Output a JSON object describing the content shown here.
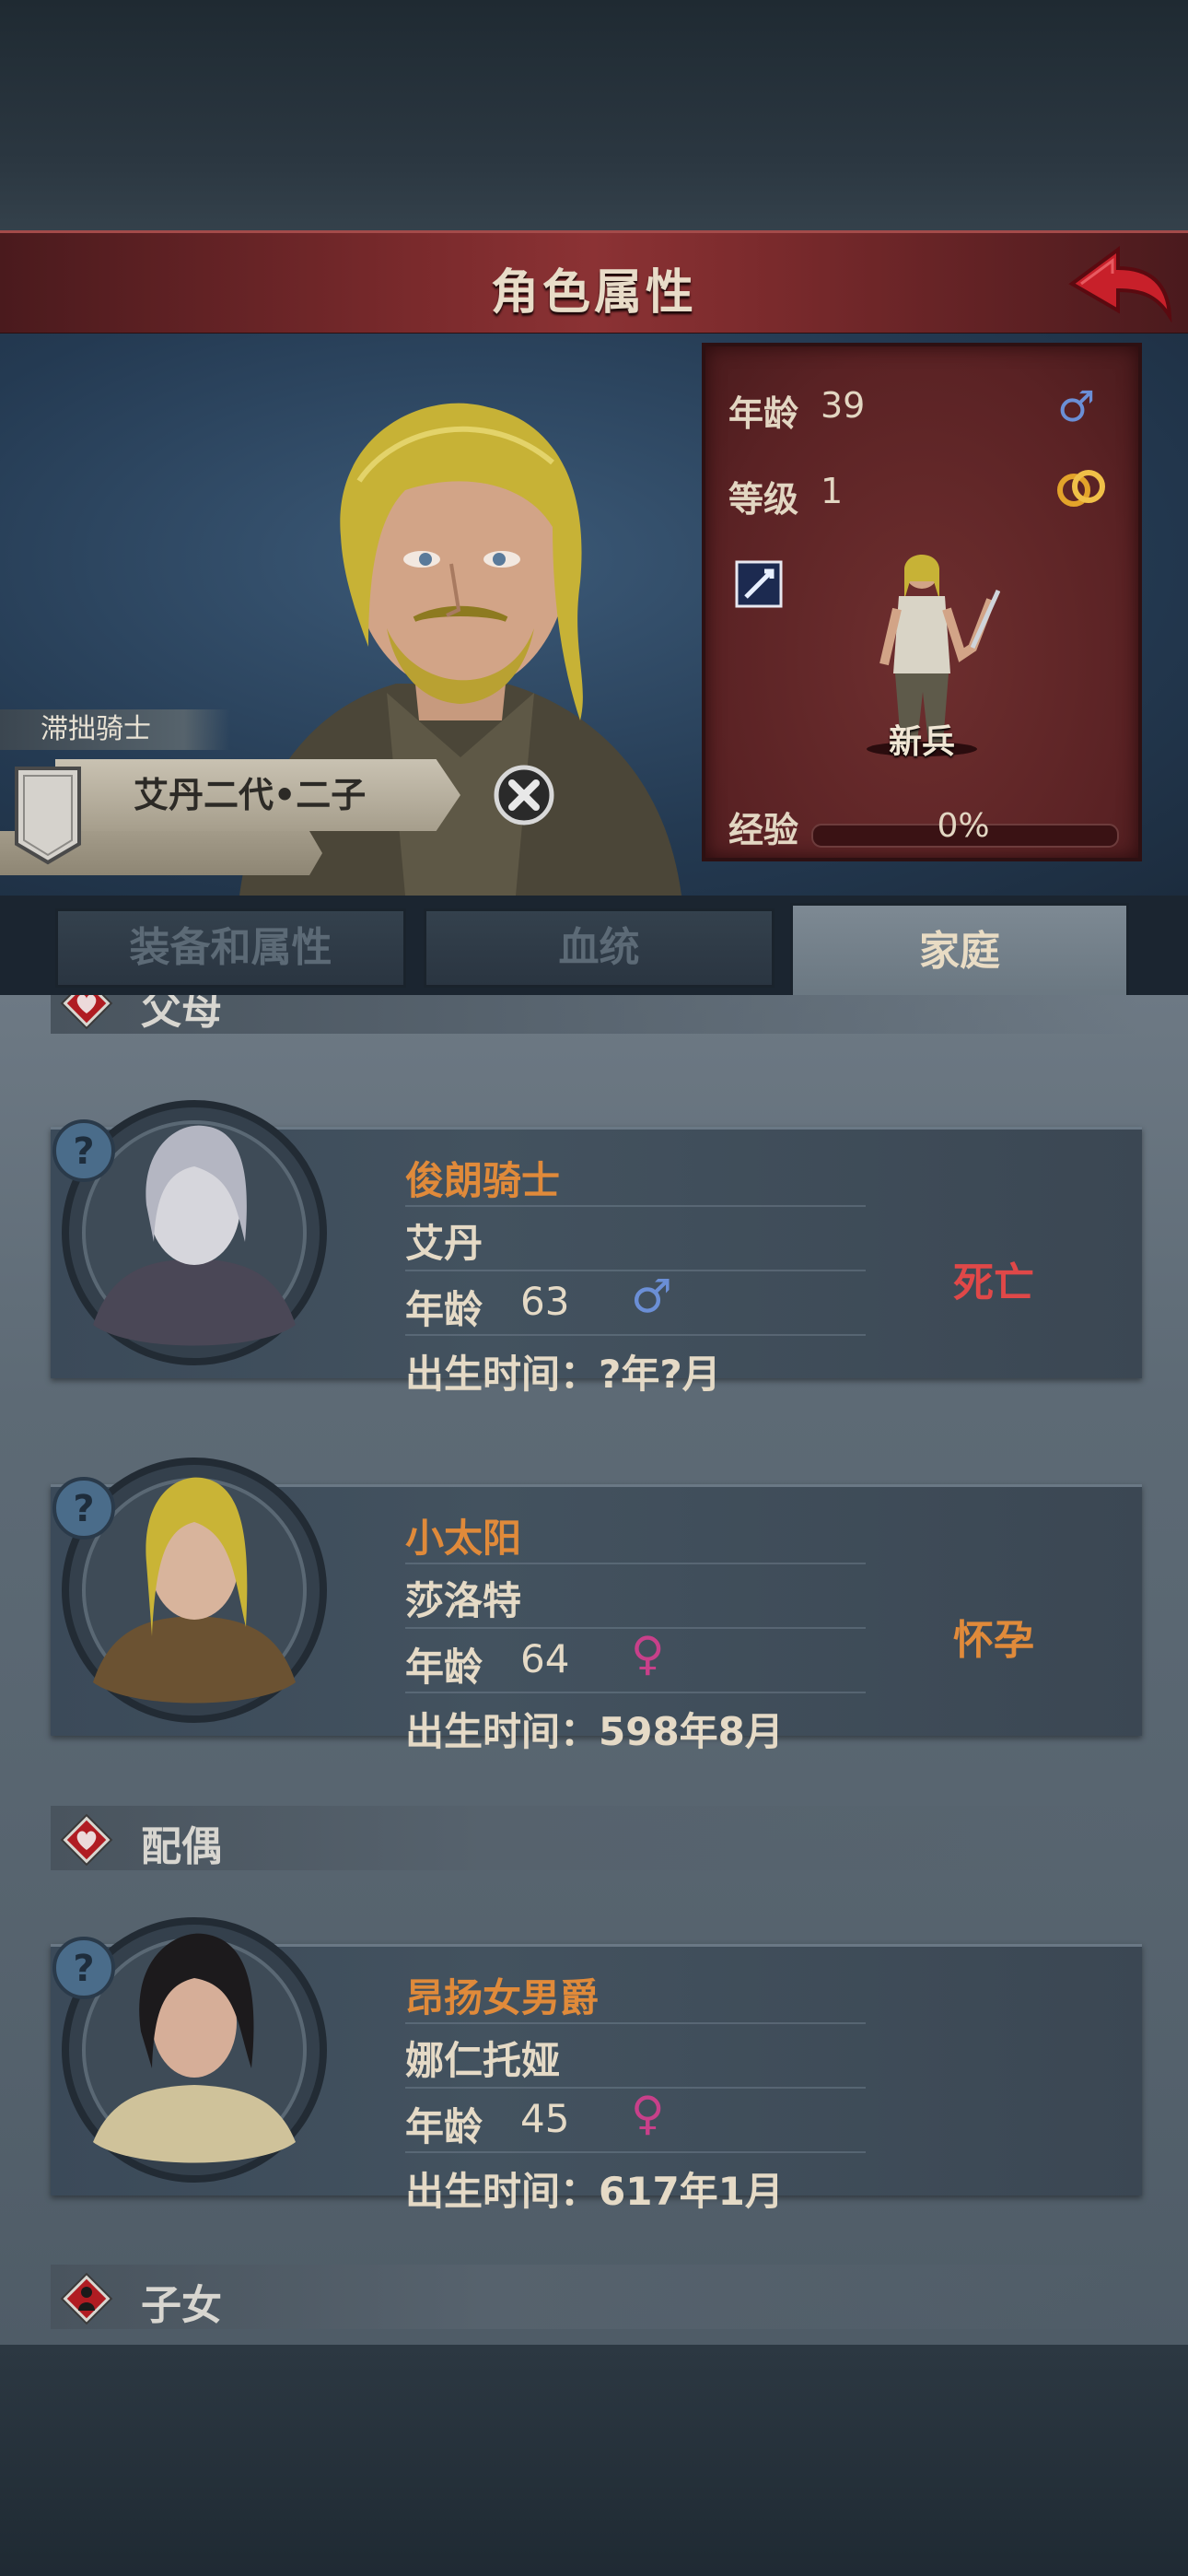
{
  "header": {
    "title": "角色属性"
  },
  "hero": {
    "title_tag": "滞拙骑士",
    "name": "艾丹二代•二子"
  },
  "stats": {
    "age_label": "年龄",
    "age_value": "39",
    "level_label": "等级",
    "level_value": "1",
    "rank": "新兵",
    "xp_label": "经验",
    "xp_value": "0%",
    "xp_fraction": 0
  },
  "tabs": [
    {
      "label": "装备和属性",
      "active": false
    },
    {
      "label": "血统",
      "active": false
    },
    {
      "label": "家庭",
      "active": true
    }
  ],
  "sections": {
    "parents": "父母",
    "spouse": "配偶",
    "children": "子女"
  },
  "family": [
    {
      "title": "俊朗骑士",
      "name": "艾丹",
      "age_label": "年龄",
      "age": "63",
      "sex": "♂",
      "birth": "出生时间：?年?月",
      "status": "死亡",
      "status_color": "#e04848"
    },
    {
      "title": "小太阳",
      "name": "莎洛特",
      "age_label": "年龄",
      "age": "64",
      "sex": "♀",
      "birth": "出生时间：598年8月",
      "status": "怀孕",
      "status_color": "#e08a3a"
    },
    {
      "title": "昂扬女男爵",
      "name": "娜仁托娅",
      "age_label": "年龄",
      "age": "45",
      "sex": "♀",
      "birth": "出生时间：617年1月",
      "status": "",
      "status_color": ""
    }
  ],
  "colors": {
    "male": "#6b8fd6",
    "female": "#c8408a",
    "accent": "#e08a3a"
  }
}
